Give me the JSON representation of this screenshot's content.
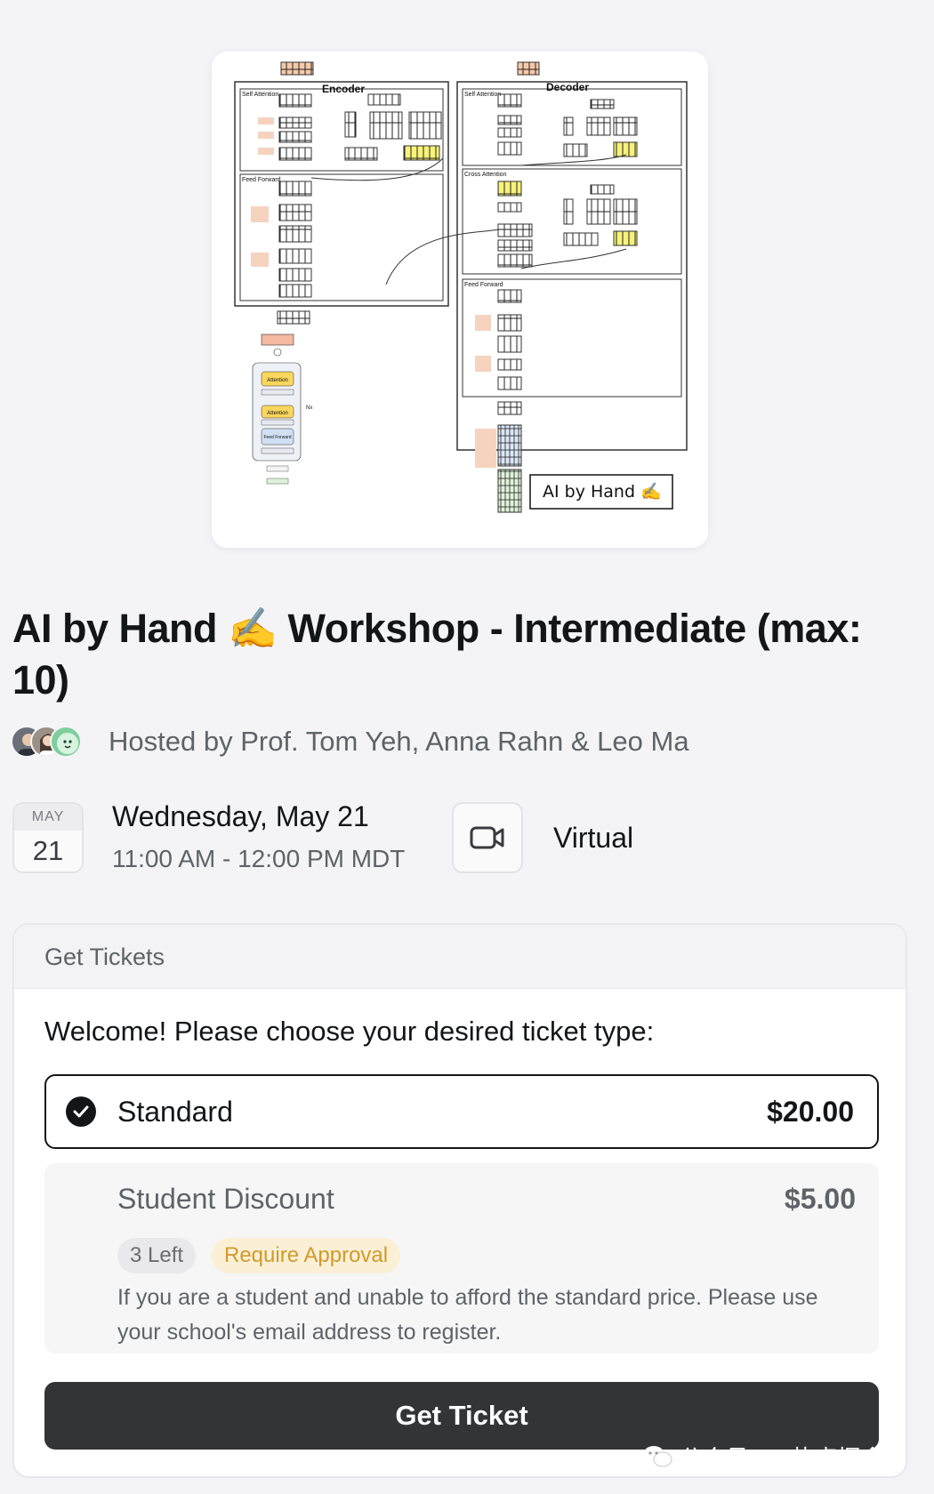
{
  "cover": {
    "encoder_label": "Encoder",
    "decoder_label": "Decoder",
    "self_attention_label": "Self Attention",
    "feed_forward_label": "Feed Forward",
    "cross_attention_label": "Cross Attention",
    "nx_label": "Nx",
    "diagram_attention_label": "Attention",
    "diagram_feed_forward_label": "Feed Forward",
    "stamp_text": "AI by Hand ✍️"
  },
  "event": {
    "title": "AI by Hand ✍️ Workshop - Intermediate (max: 10)",
    "hosted_by": "Hosted by Prof. Tom Yeh, Anna Rahn & Leo Ma",
    "date_month": "MAY",
    "date_day": "21",
    "date_full": "Wednesday, May 21",
    "time_range": "11:00 AM - 12:00 PM MDT",
    "location": "Virtual"
  },
  "tickets": {
    "header": "Get Tickets",
    "welcome": "Welcome! Please choose your desired ticket type:",
    "options": [
      {
        "name": "Standard",
        "price": "$20.00",
        "selected": true
      },
      {
        "name": "Student Discount",
        "price": "$5.00",
        "selected": false,
        "remaining": "3 Left",
        "approval": "Require Approval",
        "description": "If you are a student and unable to afford the standard price. Please use your school's email address to register."
      }
    ],
    "button_label": "Get Ticket"
  },
  "watermark": {
    "text": "公众号 · AI热点掘金"
  },
  "colors": {
    "primary": "#131517",
    "muted": "#5f6368",
    "approval": "#d19a2a",
    "button": "#333436"
  }
}
